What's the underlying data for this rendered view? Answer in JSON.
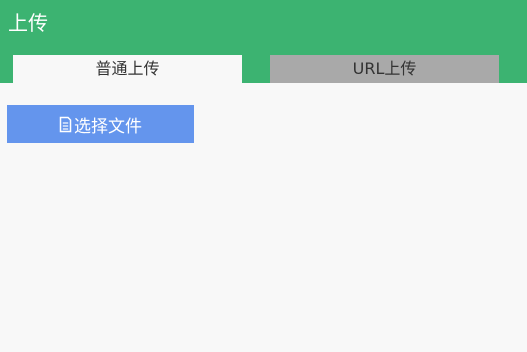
{
  "header": {
    "title": "上传"
  },
  "tabs": [
    {
      "label": "普通上传",
      "active": true
    },
    {
      "label": "URL上传",
      "active": false
    }
  ],
  "upload": {
    "button_label": "选择文件",
    "button_icon": "file-icon"
  },
  "colors": {
    "header_bg": "#3cb371",
    "button_bg": "#6495ed",
    "inactive_tab_bg": "#a9a9a9",
    "page_bg": "#f8f8f8"
  }
}
